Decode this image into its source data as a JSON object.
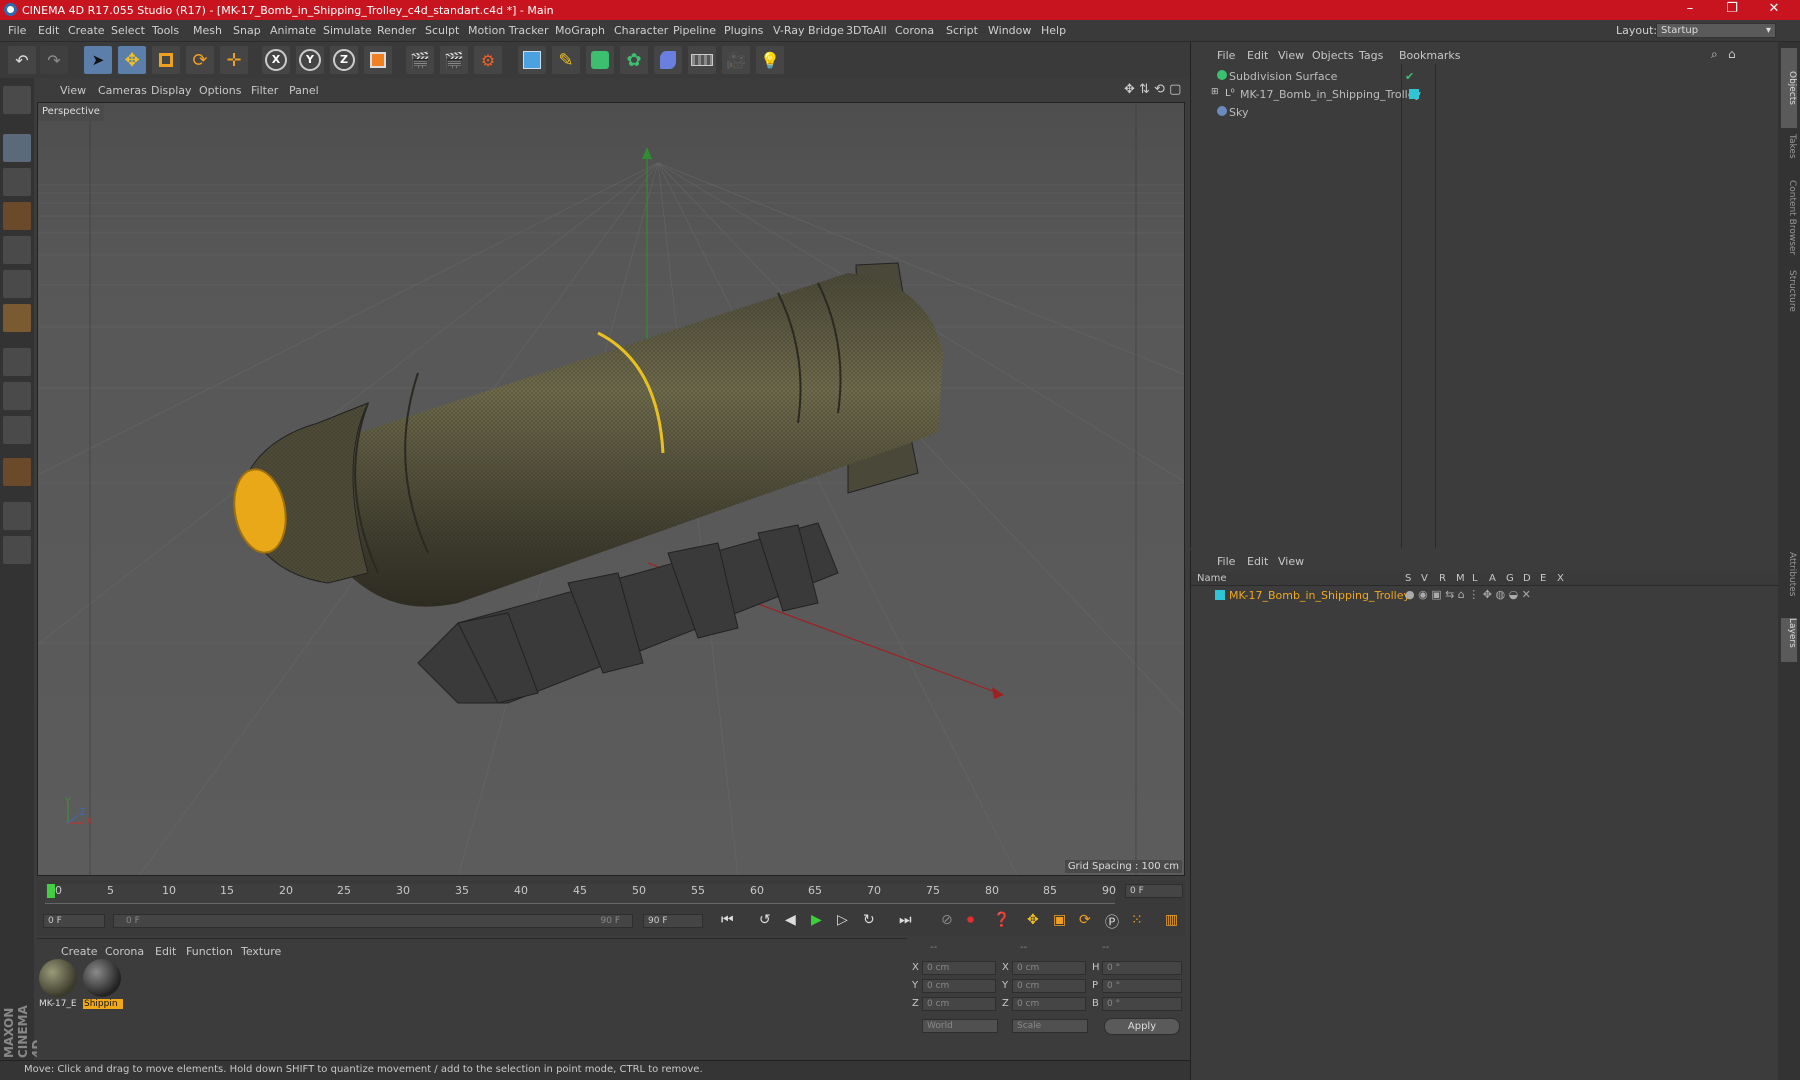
{
  "window": {
    "title": "CINEMA 4D R17.055 Studio (R17) - [MK-17_Bomb_in_Shipping_Trolley_c4d_standart.c4d *] - Main",
    "controls": [
      "–",
      "❐",
      "✕"
    ]
  },
  "menubar": {
    "items": [
      "File",
      "Edit",
      "Create",
      "Select",
      "Tools",
      "Mesh",
      "Snap",
      "Animate",
      "Simulate",
      "Render",
      "Sculpt",
      "Motion Tracker",
      "MoGraph",
      "Character",
      "Pipeline",
      "Plugins",
      "V-Ray Bridge",
      "3DToAll",
      "Corona",
      "Script",
      "Window",
      "Help"
    ],
    "layout_label": "Layout:",
    "layout_value": "Startup"
  },
  "toolbar": {
    "icons": [
      "undo-icon",
      "redo-icon",
      "select-arrow-icon",
      "move-icon",
      "scale-icon",
      "rotate-icon",
      "transform-icon",
      "x-axis-icon",
      "y-axis-icon",
      "z-axis-icon",
      "coordinate-system-icon",
      "render-view-icon",
      "render-picture-viewer-icon",
      "render-settings-icon",
      "cube-primitive-icon",
      "spline-pen-icon",
      "subdivision-icon",
      "array-icon",
      "deformer-icon",
      "floor-icon",
      "camera-icon",
      "light-icon"
    ]
  },
  "viewport": {
    "menu": [
      "View",
      "Cameras",
      "Display",
      "Options",
      "Filter",
      "Panel"
    ],
    "label": "Perspective",
    "grid_spacing": "Grid Spacing : 100 cm",
    "axis_labels": {
      "y": "Y",
      "x": "X",
      "z": "Z"
    }
  },
  "timeline": {
    "ticks": [
      "0",
      "5",
      "10",
      "15",
      "20",
      "25",
      "30",
      "35",
      "40",
      "45",
      "50",
      "55",
      "60",
      "65",
      "70",
      "75",
      "80",
      "85",
      "90"
    ],
    "end_frame": "0 F",
    "start_field": "0 F",
    "slider_start": "0 F",
    "slider_end": "90 F",
    "end_field": "90 F"
  },
  "materials": {
    "menu": [
      "Create",
      "Corona",
      "Edit",
      "Function",
      "Texture"
    ],
    "items": [
      {
        "label": "MK-17_E",
        "selected": false
      },
      {
        "label": "Shippin",
        "selected": true
      }
    ]
  },
  "coordinates": {
    "headers": [
      "--",
      "--",
      "--"
    ],
    "rows": [
      {
        "a": "X",
        "av": "0 cm",
        "b": "X",
        "bv": "0 cm",
        "c": "H",
        "cv": "0 °"
      },
      {
        "a": "Y",
        "av": "0 cm",
        "b": "Y",
        "bv": "0 cm",
        "c": "P",
        "cv": "0 °"
      },
      {
        "a": "Z",
        "av": "0 cm",
        "b": "Z",
        "bv": "0 cm",
        "c": "B",
        "cv": "0 °"
      }
    ],
    "mode1": "World",
    "mode2": "Scale",
    "apply": "Apply"
  },
  "objects": {
    "menu": [
      "File",
      "Edit",
      "View",
      "Objects",
      "Tags",
      "Bookmarks"
    ],
    "items": [
      {
        "name": "Subdivision Surface",
        "color": "#7ec26a"
      },
      {
        "name": "MK-17_Bomb_in_Shipping_Trolley",
        "color": "#bcbcbc"
      },
      {
        "name": "Sky",
        "color": "#bcbcbc"
      }
    ]
  },
  "layers": {
    "menu": [
      "File",
      "Edit",
      "View"
    ],
    "columns": [
      "Name",
      "S",
      "V",
      "R",
      "M",
      "L",
      "A",
      "G",
      "D",
      "E",
      "X"
    ],
    "items": [
      {
        "name": "MK-17_Bomb_in_Shipping_Trolley",
        "color": "#2ec6d6"
      }
    ]
  },
  "sidetabs": [
    "Objects",
    "Takes",
    "Content Browser",
    "Structure",
    "Attributes",
    "Layers"
  ],
  "branding": "MAXON CINEMA 4D",
  "status": "Move: Click and drag to move elements. Hold down SHIFT to quantize movement / add to the selection in point mode, CTRL to remove."
}
